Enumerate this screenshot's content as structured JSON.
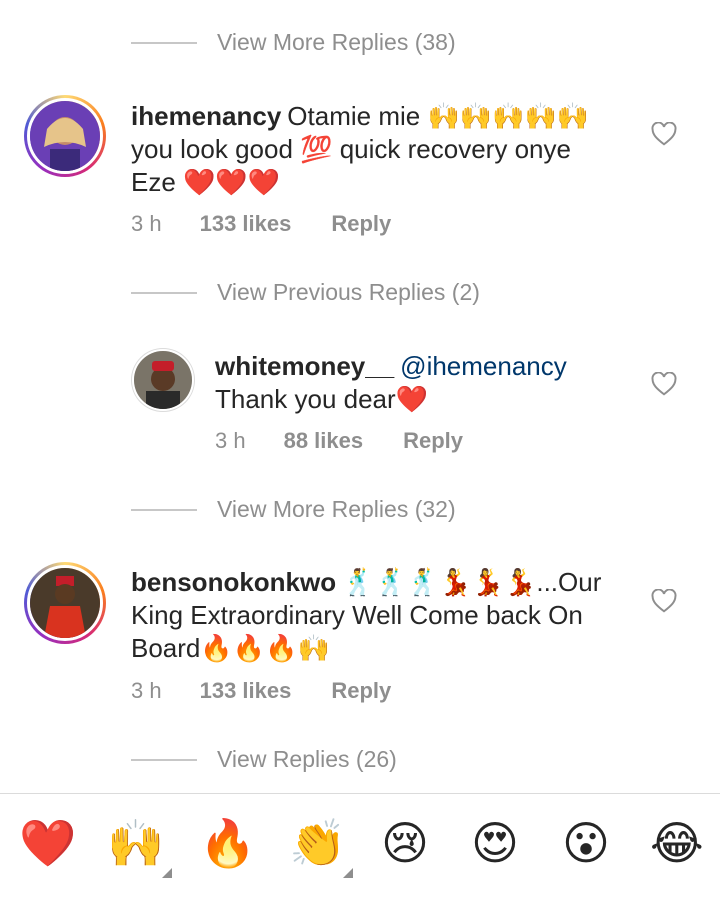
{
  "thread": {
    "view_more_1": "View More Replies (38)",
    "view_previous": "View Previous Replies (2)",
    "view_more_2": "View More Replies (32)",
    "view_replies": "View Replies (26)"
  },
  "comments": [
    {
      "username": "ihemenancy",
      "line1": "Otamie mie 🙌🙌🙌🙌🙌",
      "line2": "you look good 💯 quick recovery onye",
      "line3": "Eze ❤️❤️❤️",
      "time": "3 h",
      "likes": "133 likes",
      "reply": "Reply"
    },
    {
      "username": "whitemoney__",
      "mention": "@ihemenancy",
      "line2": "Thank you dear❤️",
      "time": "3 h",
      "likes": "88 likes",
      "reply": "Reply"
    },
    {
      "username": "bensonokonkwo",
      "line1": "🕺🕺🕺💃💃💃...Our",
      "line2": "King Extraordinary Well Come back On",
      "line3": "Board🔥🔥🔥🙌",
      "time": "3 h",
      "likes": "133 likes",
      "reply": "Reply"
    }
  ],
  "reaction_bar": {
    "emojis": [
      "❤️",
      "🙌",
      "🔥",
      "👏",
      "😢",
      "😍",
      "😮",
      "😂"
    ],
    "emoji_names": [
      "red-heart",
      "raising-hands",
      "fire",
      "clapping-hands",
      "crying-face",
      "heart-eyes",
      "surprised-face",
      "tears-of-joy"
    ]
  },
  "colors": {
    "text": "#262626",
    "secondary": "#8e8e8e",
    "mention": "#00376b",
    "story_ring_start": "#feda75",
    "story_ring_end": "#4f5bd5"
  }
}
